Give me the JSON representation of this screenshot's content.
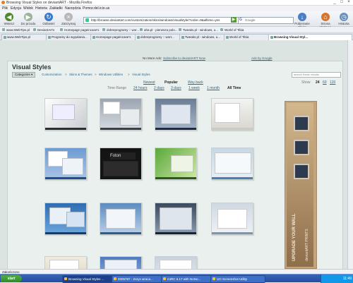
{
  "window": {
    "title": "Browsing Visual Styles on deviantART - Mozilla Firefox"
  },
  "menu": [
    "Plik",
    "Edycja",
    "Widok",
    "Historia",
    "Zakładki",
    "Narzędzia",
    "Pomoc",
    "del.icio.us"
  ],
  "nav": {
    "back": "Wstecz",
    "forward": "Do przodu",
    "reload": "Odśwież",
    "stop": "Zatrzymaj",
    "url": "http://browse.deviantart.com/customization/skins/windows/visualstyle/?order=9&alltime=yes",
    "search_placeholder": "Google",
    "downloads": "Pobieranie plików",
    "home": "Strona startowa",
    "history": "Historia"
  },
  "bookmarks": [
    "www.WebTips.pl",
    "DeviantArt's",
    "Homepage pageincase's",
    "dobreprogramy :: wor...",
    "aha.pl - pierwsza polo...",
    "Tweaks.pl - windows, u...",
    "World of Tibia"
  ],
  "tabs": [
    "www.WebTips.pl",
    "Programy do wypalania...",
    "Homepage pageincase's",
    "dobreprogramy :: wort...",
    "Tweaks.pl - windows, u...",
    "World of Tibia",
    "Browsing Visual Styl..."
  ],
  "ad_bar": {
    "text": "No More Ads:",
    "link": "Subscribe to deviantART Now",
    "google": "Ads by Google"
  },
  "page": {
    "title": "Visual Styles",
    "categories_button": "Categories",
    "breadcrumb": [
      "Customization",
      "Skins & Themes",
      "Windows Utilities",
      "Visual Styles"
    ],
    "filter_placeholder": "search these results",
    "sort": {
      "newest": "Newest",
      "popular": "Popular",
      "way_back": "Way back"
    },
    "time_range": {
      "label": "Time Range",
      "options": [
        "24 hours",
        "2 days",
        "3 days",
        "1 week",
        "1 month",
        "All Time"
      ]
    },
    "show": {
      "label": "Show",
      "options": [
        "24",
        "60",
        "120"
      ]
    }
  },
  "ad_banner": {
    "line1": "UPGRADE YOUR WALL",
    "line2": "deviantART PRINTS"
  },
  "status": "Zakończono",
  "taskbar": {
    "start": "start",
    "tasks": [
      "Browsing Visual Styles ...",
      "0005787 - Zarys wraca...",
      "mIRC 6.17 with NoNo...",
      "UO Screenshot Utility"
    ],
    "clock": "11:49"
  },
  "colors": {
    "taskbar": "#244c9f",
    "panel": "#eaf0ee",
    "link": "#33688a"
  }
}
